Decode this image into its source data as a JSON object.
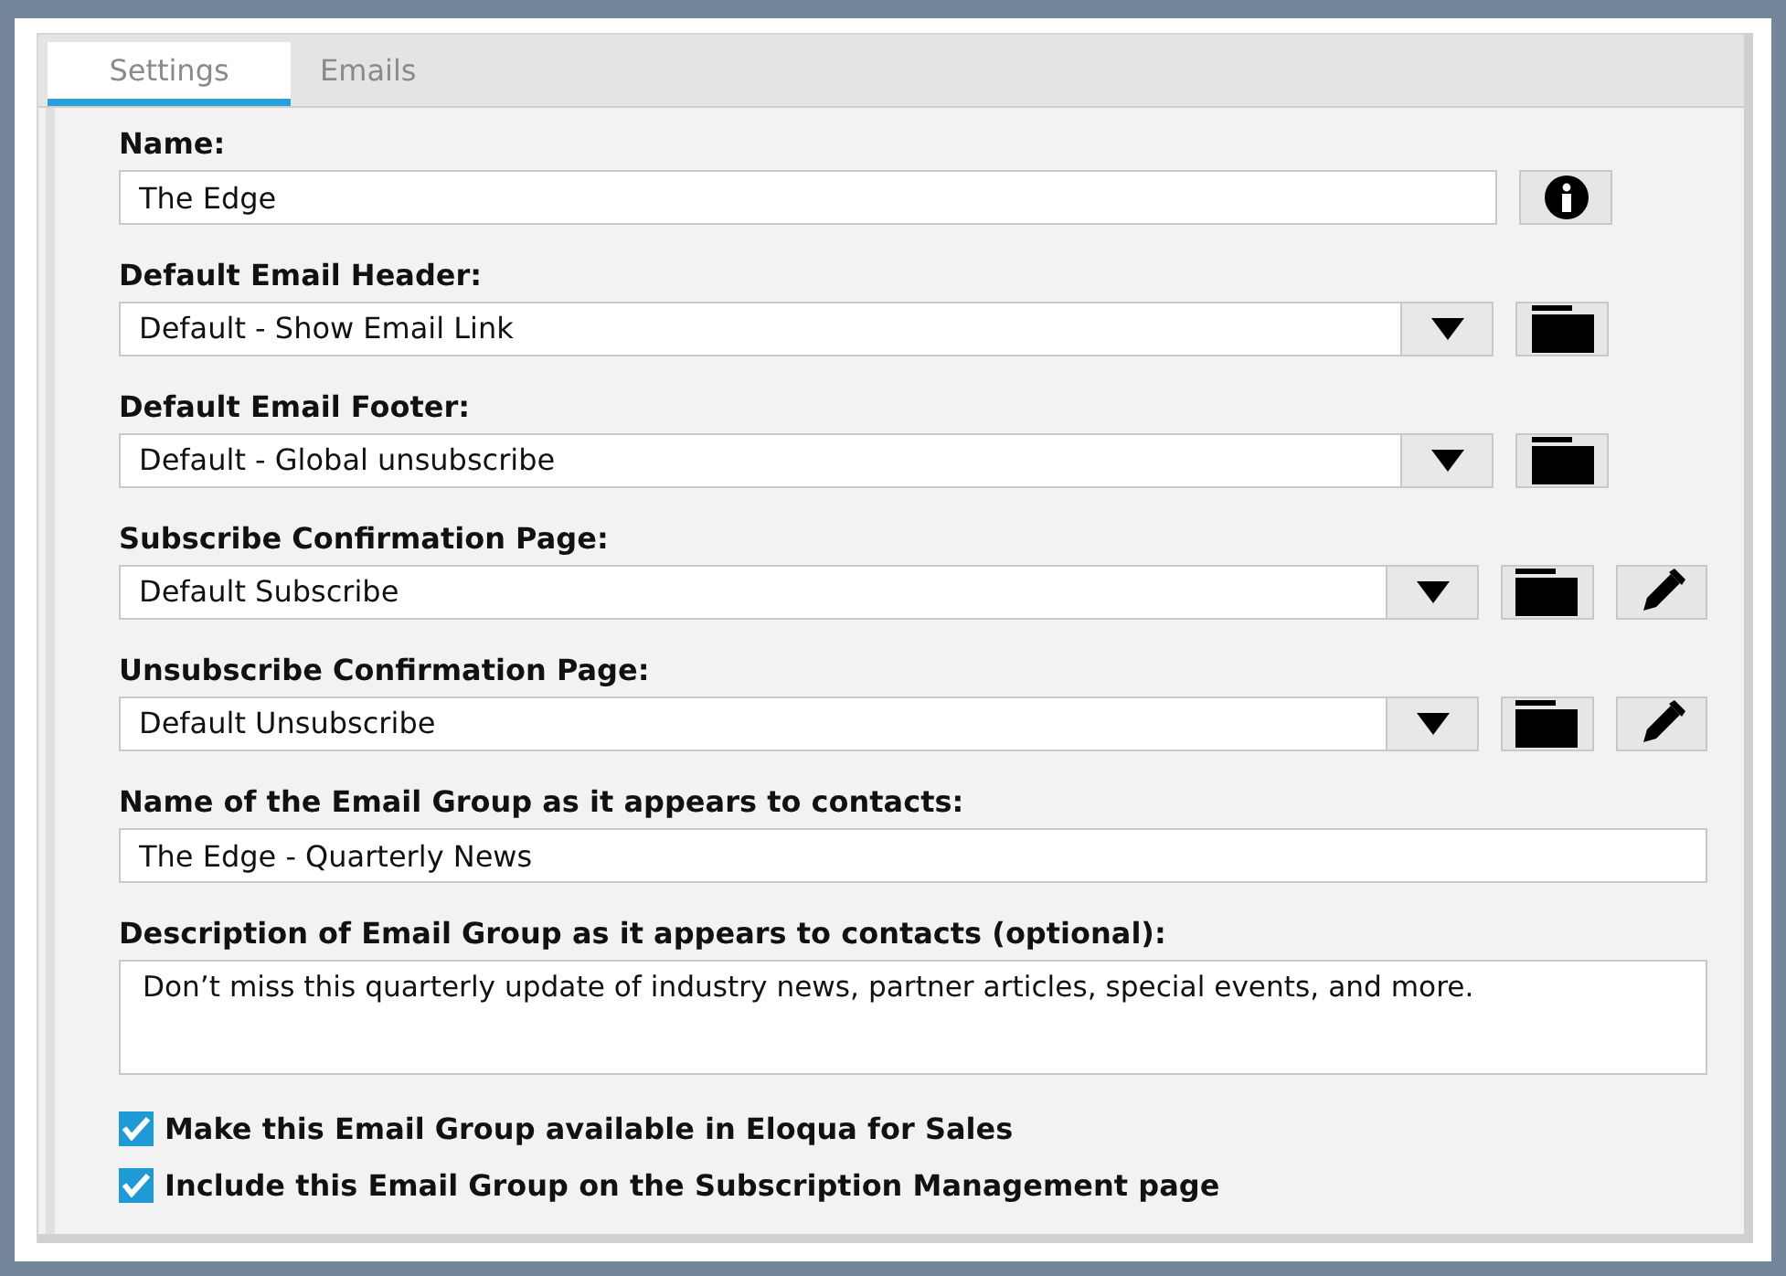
{
  "tabs": [
    {
      "label": "Settings",
      "selected": true
    },
    {
      "label": "Emails",
      "selected": false
    }
  ],
  "fields": [
    {
      "kind": "text",
      "label": "Name:",
      "value": "The Edge",
      "buttons": [
        {
          "kind": "info"
        }
      ]
    },
    {
      "kind": "select",
      "label": "Default Email Header:",
      "value": "Default - Show Email Link",
      "buttons": [
        {
          "kind": "folder"
        }
      ]
    },
    {
      "kind": "select",
      "label": "Default Email Footer:",
      "value": "Default - Global unsubscribe",
      "buttons": [
        {
          "kind": "folder"
        }
      ]
    },
    {
      "kind": "select",
      "label": "Subscribe Confirmation Page:",
      "value": "Default Subscribe",
      "buttons": [
        {
          "kind": "folder"
        },
        {
          "kind": "edit"
        }
      ]
    },
    {
      "kind": "select",
      "label": "Unsubscribe Confirmation Page:",
      "value": "Default Unsubscribe",
      "buttons": [
        {
          "kind": "folder"
        },
        {
          "kind": "edit"
        }
      ]
    },
    {
      "kind": "text",
      "label": "Name of the Email Group as it appears to contacts:",
      "value": "The Edge - Quarterly News"
    },
    {
      "kind": "textarea",
      "label": "Description of Email Group as it appears to contacts (optional):",
      "value": "Don’t miss this quarterly update of industry news, partner articles, special events, and more."
    }
  ],
  "checkboxes": [
    {
      "label": "Make this Email Group available in Eloqua for Sales",
      "checked": true
    },
    {
      "label": "Include this Email Group on the Subscription Management page",
      "checked": true
    }
  ]
}
